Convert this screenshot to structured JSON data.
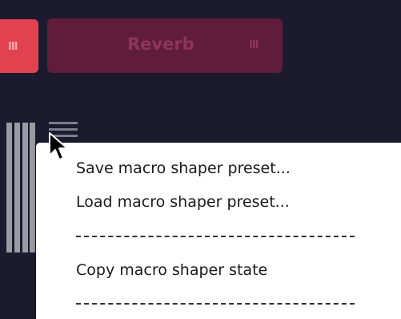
{
  "modules": {
    "left_grip": "III",
    "reverb": {
      "name": "Reverb",
      "grip": "III"
    }
  },
  "icons": {
    "menu": "hamburger-icon",
    "cursor": "arrow-cursor-icon"
  },
  "context_menu": {
    "items": [
      "Save macro shaper preset...",
      "Load macro shaper preset...",
      "Copy macro shaper state"
    ]
  },
  "colors": {
    "background": "#1b1a2f",
    "module_active": "#e2424f",
    "module_inactive": "#5f1d3b",
    "menu_bg": "#ffffff"
  }
}
